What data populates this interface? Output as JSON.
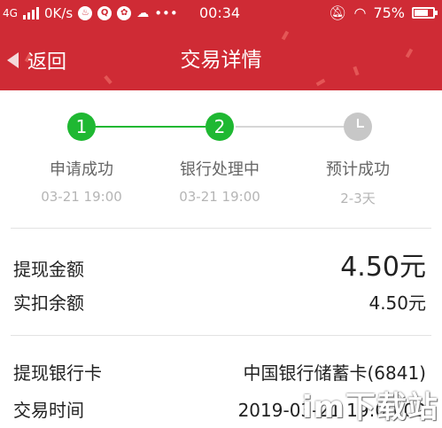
{
  "status_bar": {
    "network": "4G",
    "speed": "0K/s",
    "time": "00:34",
    "battery": "75%"
  },
  "nav": {
    "back_label": "返回",
    "title": "交易详情"
  },
  "steps": [
    {
      "number": "1",
      "label": "申请成功",
      "time": "03-21 19:00",
      "state": "done"
    },
    {
      "number": "2",
      "label": "银行处理中",
      "time": "03-21 19:00",
      "state": "done"
    },
    {
      "number": "",
      "label": "预计成功",
      "time": "2-3天",
      "state": "pending"
    }
  ],
  "amounts": {
    "withdraw_label": "提现金额",
    "withdraw_value": "4.50元",
    "deduct_label": "实扣余额",
    "deduct_value": "4.50元"
  },
  "details": {
    "card_label": "提现银行卡",
    "card_value": "中国银行储蓄卡(6841)",
    "time_label": "交易时间",
    "time_value": "2019-03-21 19:00:02"
  },
  "watermark": "im下载站",
  "colors": {
    "header": "#cf2b35",
    "step_done": "#1fb832",
    "step_pending": "#c7c7c7"
  }
}
